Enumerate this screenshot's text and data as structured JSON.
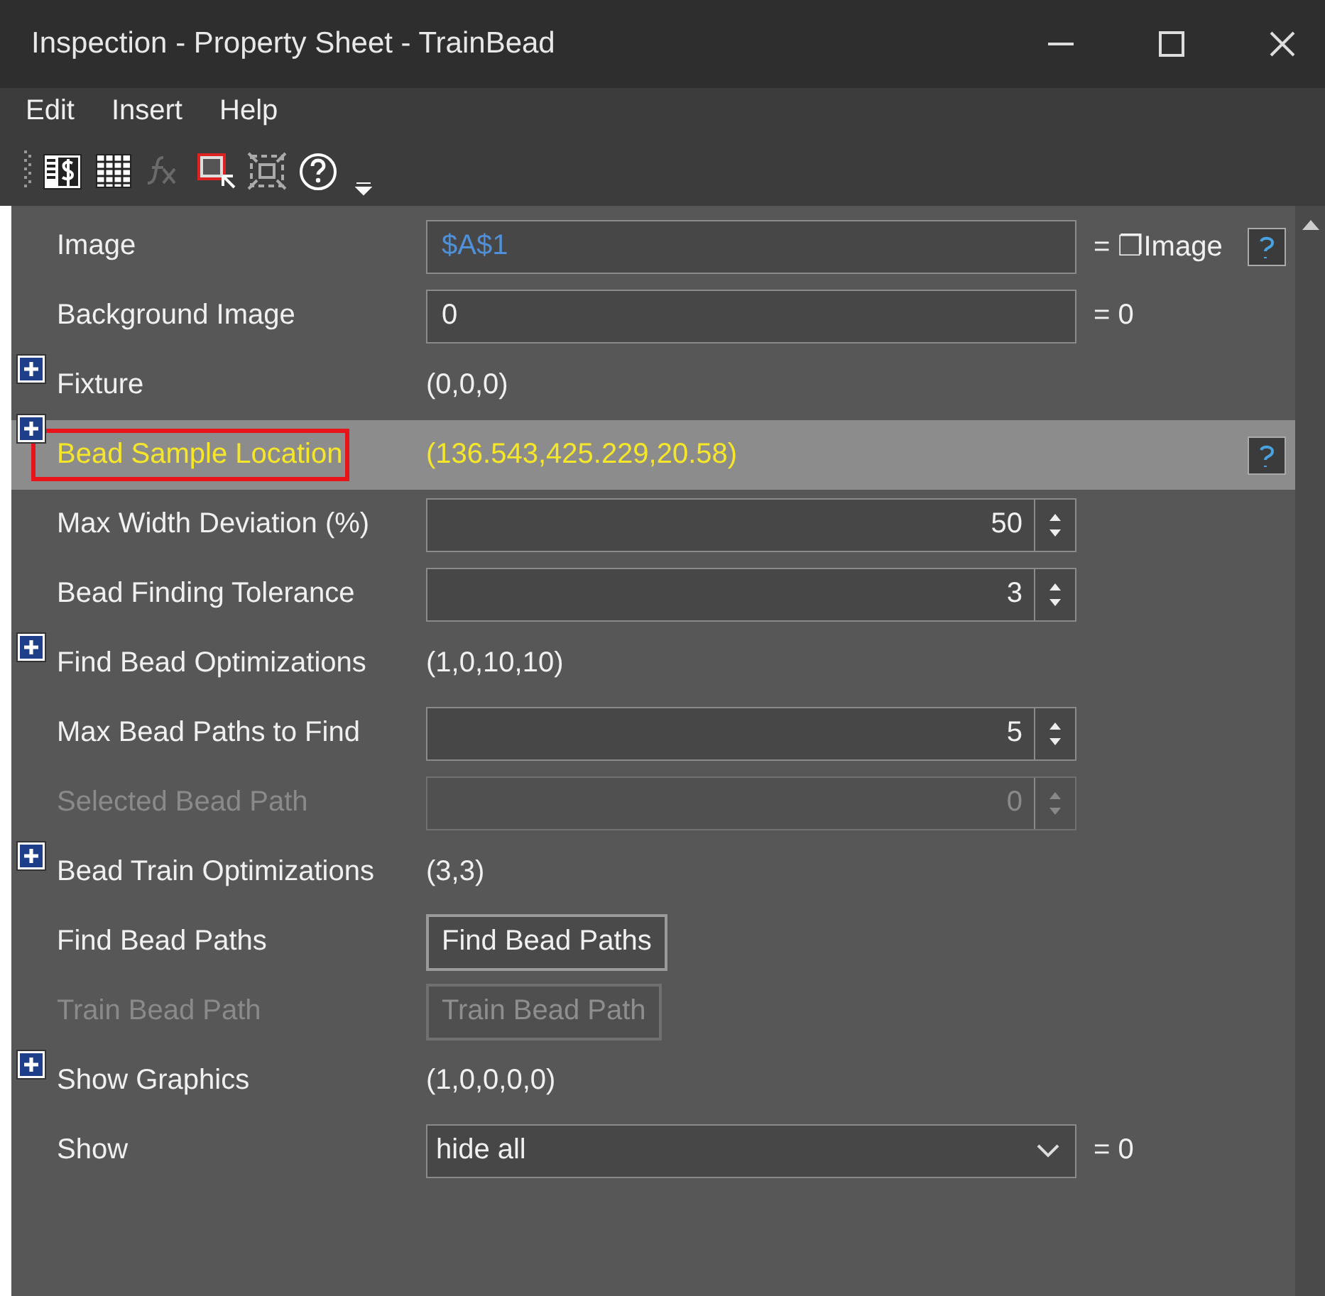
{
  "window": {
    "title": "Inspection - Property Sheet - TrainBead"
  },
  "menu": [
    "Edit",
    "Insert",
    "Help"
  ],
  "toolbar": [
    {
      "kind": "sheet"
    },
    {
      "kind": "grid"
    },
    {
      "kind": "fx"
    },
    {
      "kind": "region"
    },
    {
      "kind": "roi"
    },
    {
      "kind": "help"
    },
    {
      "kind": "overflow"
    }
  ],
  "rows": [
    {
      "kind": "field",
      "label": "Image",
      "value": "$A$1",
      "linked": true,
      "suffix": "= ❐Image",
      "help": true,
      "selected": false,
      "outlined": false,
      "disabled": false
    },
    {
      "kind": "field",
      "label": "Background Image",
      "value": "0",
      "linked": false,
      "suffix": "= 0",
      "help": false,
      "selected": false,
      "outlined": false,
      "disabled": false
    },
    {
      "kind": "group",
      "label": "Fixture",
      "value": "(0,0,0)",
      "help": false,
      "selected": false,
      "outlined": false,
      "disabled": false
    },
    {
      "kind": "group",
      "label": "Bead Sample Location",
      "value": "(136.543,425.229,20.58)",
      "help": true,
      "selected": true,
      "outlined": true,
      "disabled": false
    },
    {
      "kind": "spin",
      "label": "Max Width Deviation (%)",
      "value": "50",
      "help": false,
      "selected": false,
      "outlined": false,
      "disabled": false
    },
    {
      "kind": "spin",
      "label": "Bead Finding Tolerance",
      "value": "3",
      "help": false,
      "selected": false,
      "outlined": false,
      "disabled": false
    },
    {
      "kind": "group",
      "label": "Find Bead Optimizations",
      "value": "(1,0,10,10)",
      "help": false,
      "selected": false,
      "outlined": false,
      "disabled": false
    },
    {
      "kind": "spin",
      "label": "Max Bead Paths to Find",
      "value": "5",
      "help": false,
      "selected": false,
      "outlined": false,
      "disabled": false
    },
    {
      "kind": "spin",
      "label": "Selected Bead Path",
      "value": "0",
      "help": false,
      "selected": false,
      "outlined": false,
      "disabled": true
    },
    {
      "kind": "group",
      "label": "Bead Train Optimizations",
      "value": "(3,3)",
      "help": false,
      "selected": false,
      "outlined": false,
      "disabled": false
    },
    {
      "kind": "button",
      "label": "Find Bead Paths",
      "value": "Find Bead Paths",
      "help": false,
      "selected": false,
      "outlined": false,
      "disabled": false
    },
    {
      "kind": "button",
      "label": "Train Bead Path",
      "value": "Train Bead Path",
      "help": false,
      "selected": false,
      "outlined": false,
      "disabled": true
    },
    {
      "kind": "group",
      "label": "Show Graphics",
      "value": "(1,0,0,0,0)",
      "help": false,
      "selected": false,
      "outlined": false,
      "disabled": false
    },
    {
      "kind": "combo",
      "label": "Show",
      "value": "hide all",
      "suffix": "= 0",
      "help": false,
      "selected": false,
      "outlined": false,
      "disabled": false
    }
  ]
}
